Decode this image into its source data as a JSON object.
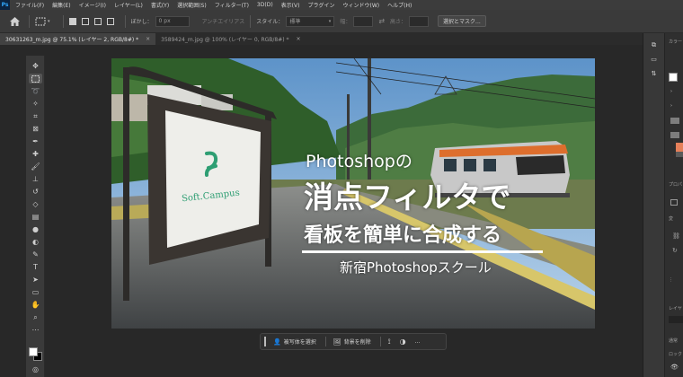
{
  "app": {
    "logo": "Ps"
  },
  "menu": [
    "ファイル(F)",
    "編集(E)",
    "イメージ(I)",
    "レイヤー(L)",
    "書式(Y)",
    "選択範囲(S)",
    "フィルター(T)",
    "3D(D)",
    "表示(V)",
    "プラグイン",
    "ウィンドウ(W)",
    "ヘルプ(H)"
  ],
  "options": {
    "feather_label": "ぼかし：",
    "feather_value": "0 px",
    "antialias_label": "アンチエイリアス",
    "style_label": "スタイル：",
    "style_value": "標準",
    "width_label": "幅：",
    "height_label": "高さ：",
    "select_mask_button": "選択とマスク..."
  },
  "tabs": [
    {
      "label": "30631263_m.jpg @ 75.1% (レイヤー 2, RGB/8#) *",
      "close": "×"
    },
    {
      "label": "3589424_m.jpg @ 100% (レイヤー 0, RGB/8#) *",
      "close": "×"
    }
  ],
  "canvas": {
    "line1": "Photoshopの",
    "line2": "消点フィルタで",
    "line3": "看板を簡単に合成する",
    "line4": "新宿Photoshopスクール",
    "sign_logo": "Soft.Campus"
  },
  "context_bar": {
    "select_subject": "被写体を選択",
    "remove_background": "背景を削除",
    "more": "…"
  },
  "right_panel": {
    "color_label": "カラー",
    "properties_label": "プロパ",
    "adjust_label": "変",
    "layers_label": "レイヤ",
    "kind_label": "通常",
    "lock_label": "ロック"
  },
  "colors": {
    "accent": "#e6805a",
    "logo_green": "#2e9e73"
  }
}
